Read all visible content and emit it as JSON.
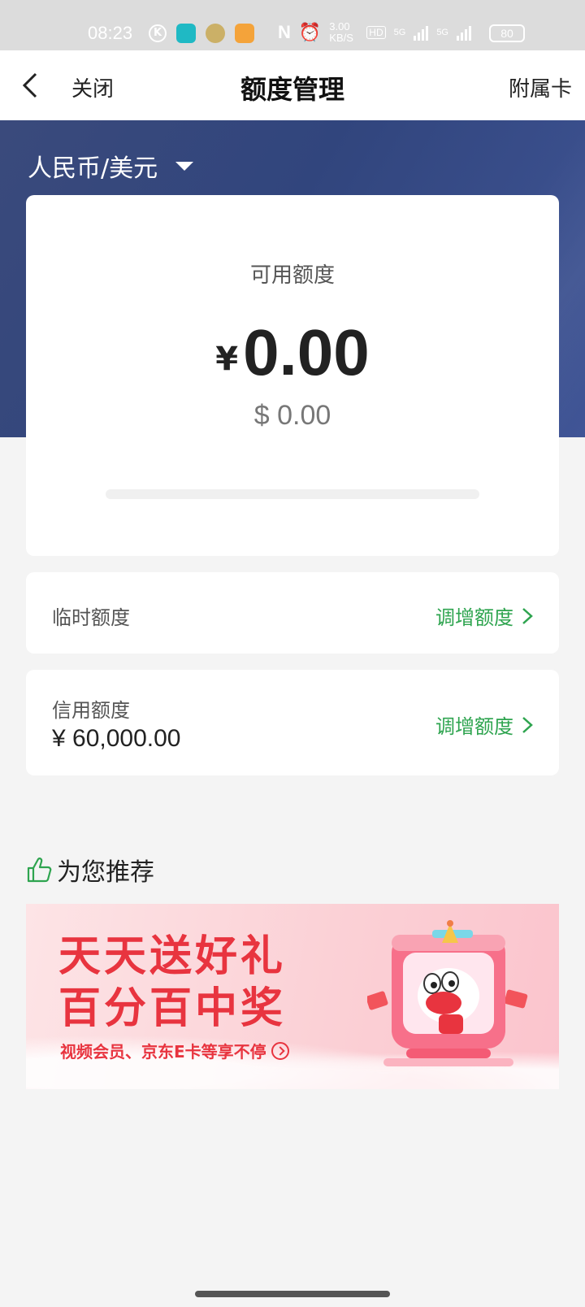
{
  "status_bar": {
    "time": "08:23",
    "app_icons": [
      "k-icon",
      "home-app-icon",
      "badge-app-icon",
      "orange-app-icon"
    ],
    "network_speed": "3.00 KB/S",
    "network_labels": [
      "HD",
      "5G",
      "5G"
    ],
    "battery": "80"
  },
  "header": {
    "close_label": "关闭",
    "title": "额度管理",
    "right_label": "附属卡"
  },
  "currency_selector": {
    "label": "人民币/美元"
  },
  "available_credit": {
    "label": "可用额度",
    "cny_symbol": "¥",
    "cny_amount": "0.00",
    "usd_amount": "$ 0.00",
    "usage_fraction": 0
  },
  "temporary_limit": {
    "label": "临时额度",
    "action": "调增额度"
  },
  "credit_limit": {
    "label": "信用额度",
    "value": "¥ 60,000.00",
    "action": "调增额度"
  },
  "recommend": {
    "title": "为您推荐",
    "banner": {
      "line1": "天天送好礼",
      "line2": "百分百中奖",
      "subtitle": "视频会员、京东E卡等享不停"
    }
  },
  "colors": {
    "accent_green": "#2ea44f",
    "banner_blue": "#31457d",
    "promo_red": "#e8343f"
  }
}
